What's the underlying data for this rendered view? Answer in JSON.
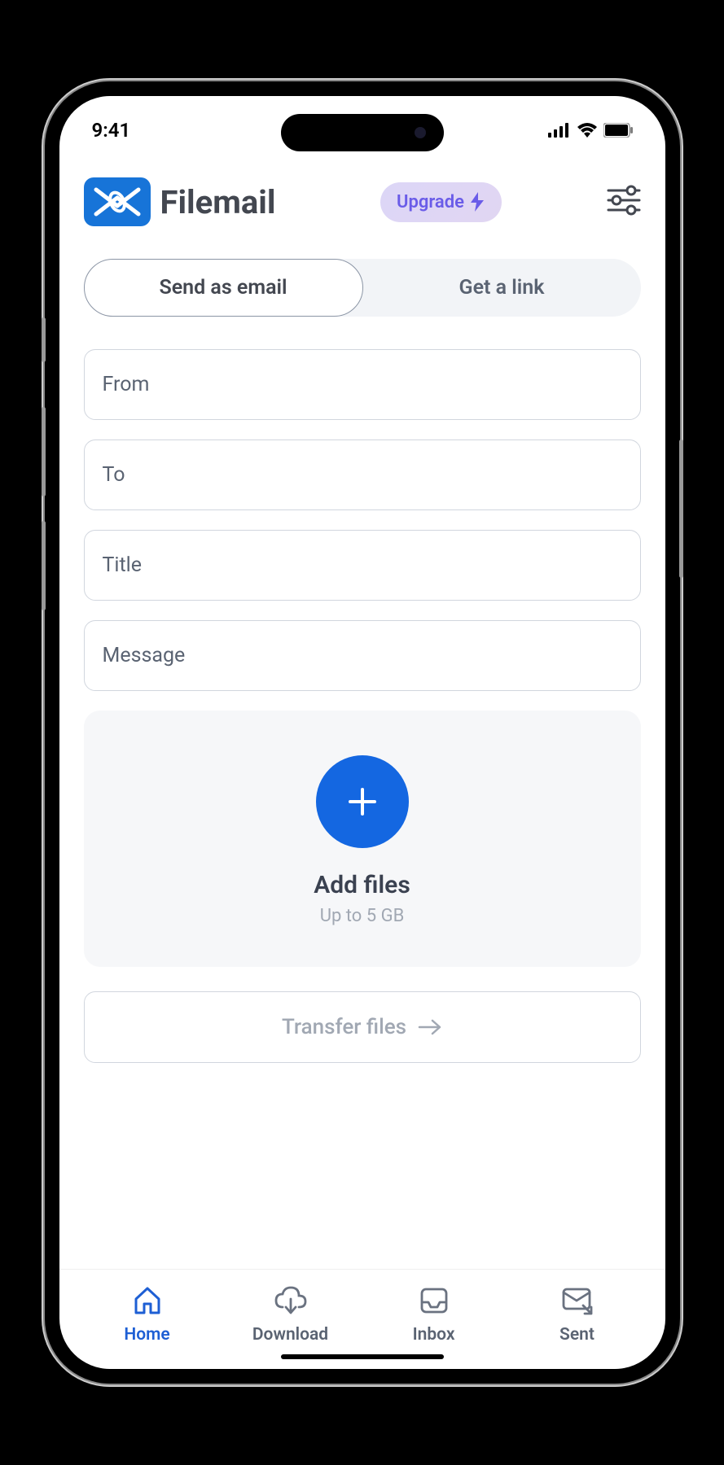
{
  "status": {
    "time": "9:41"
  },
  "header": {
    "app_name": "Filemail",
    "upgrade_label": "Upgrade"
  },
  "tabs": {
    "email": "Send as email",
    "link": "Get a link"
  },
  "form": {
    "from_placeholder": "From",
    "to_placeholder": "To",
    "title_placeholder": "Title",
    "message_placeholder": "Message"
  },
  "add_files": {
    "title": "Add files",
    "subtitle": "Up to 5 GB"
  },
  "transfer": {
    "label": "Transfer files"
  },
  "nav": {
    "home": "Home",
    "download": "Download",
    "inbox": "Inbox",
    "sent": "Sent"
  }
}
